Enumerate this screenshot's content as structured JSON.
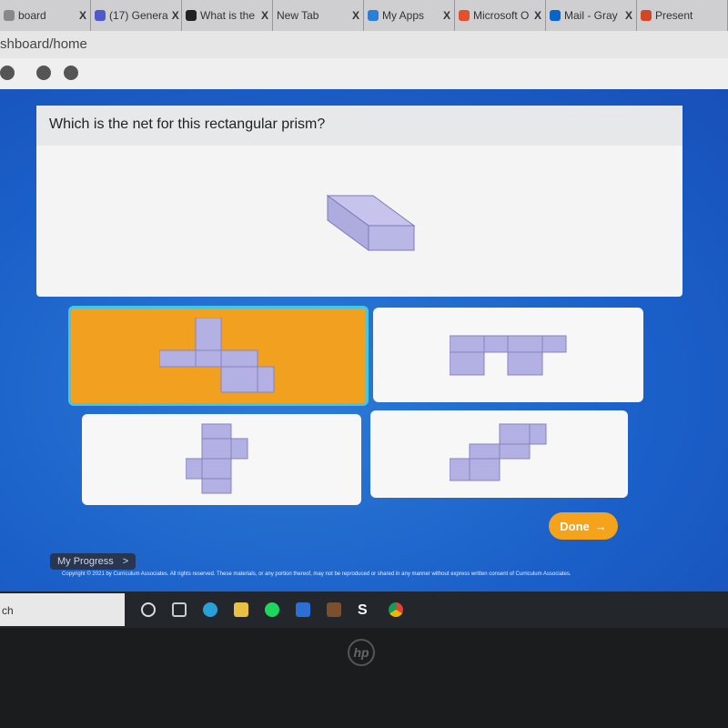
{
  "browser": {
    "tabs": [
      {
        "label": "board",
        "icon": "dashboard-icon"
      },
      {
        "label": "(17) Genera",
        "icon": "teams-icon"
      },
      {
        "label": "What is the",
        "icon": "brainly-icon"
      },
      {
        "label": "New Tab",
        "icon": ""
      },
      {
        "label": "My Apps",
        "icon": "myapps-icon"
      },
      {
        "label": "Microsoft O",
        "icon": "office-icon"
      },
      {
        "label": "Mail - Gray",
        "icon": "outlook-icon"
      },
      {
        "label": "Present",
        "icon": "powerpoint-icon"
      }
    ],
    "close_label": "X",
    "address": "shboard/home"
  },
  "question": {
    "text": "Which is the net for this rectangular prism?"
  },
  "options": [
    {
      "selected": true
    },
    {
      "selected": false
    },
    {
      "selected": false
    },
    {
      "selected": false
    }
  ],
  "done_label": "Done",
  "done_arrow": "→",
  "my_progress": "My Progress",
  "my_progress_arrow": ">",
  "copyright": "Copyright © 2021 by Curriculum Associates. All rights reserved. These materials, or any portion thereof, may not be reproduced or shared in any manner without express written consent of Curriculum Associates.",
  "taskbar": {
    "search": "ch"
  },
  "brand": "hp",
  "colors": {
    "accent": "#f5a31a",
    "selection": "#3fc8e8",
    "background": "#1a5fc8",
    "net": "#b3b1e3"
  }
}
